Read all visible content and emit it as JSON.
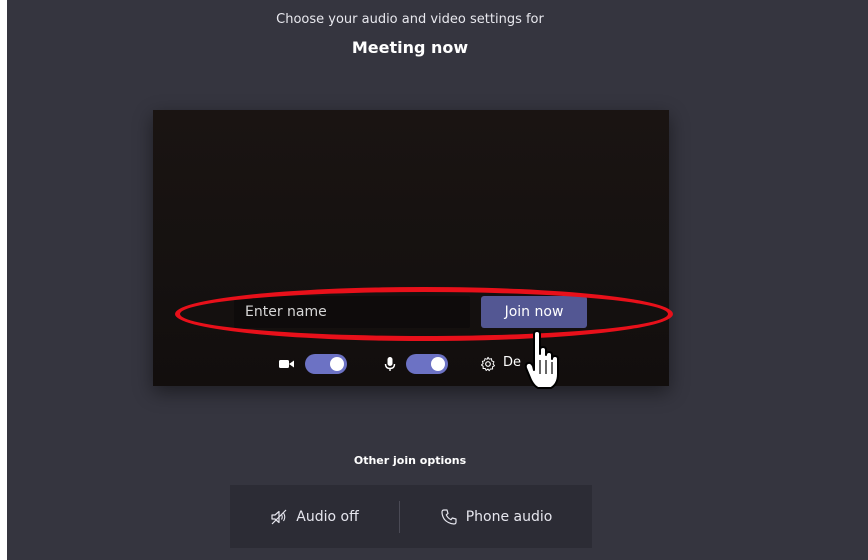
{
  "header": {
    "subtitle": "Choose your audio and video settings for",
    "title": "Meeting now"
  },
  "preview": {
    "name_placeholder": "Enter name",
    "join_label": "Join now",
    "devices_label": "De",
    "video_toggle_on": true,
    "mic_toggle_on": true
  },
  "other_options": {
    "label": "Other join options",
    "audio_off_label": "Audio off",
    "phone_audio_label": "Phone audio"
  },
  "colors": {
    "background": "#35353f",
    "accent": "#535793",
    "toggle": "#6c72c4",
    "highlight": "#e8101a"
  },
  "icons": [
    "video-camera-icon",
    "microphone-icon",
    "gear-icon",
    "speaker-off-icon",
    "phone-icon",
    "hand-cursor-icon"
  ]
}
